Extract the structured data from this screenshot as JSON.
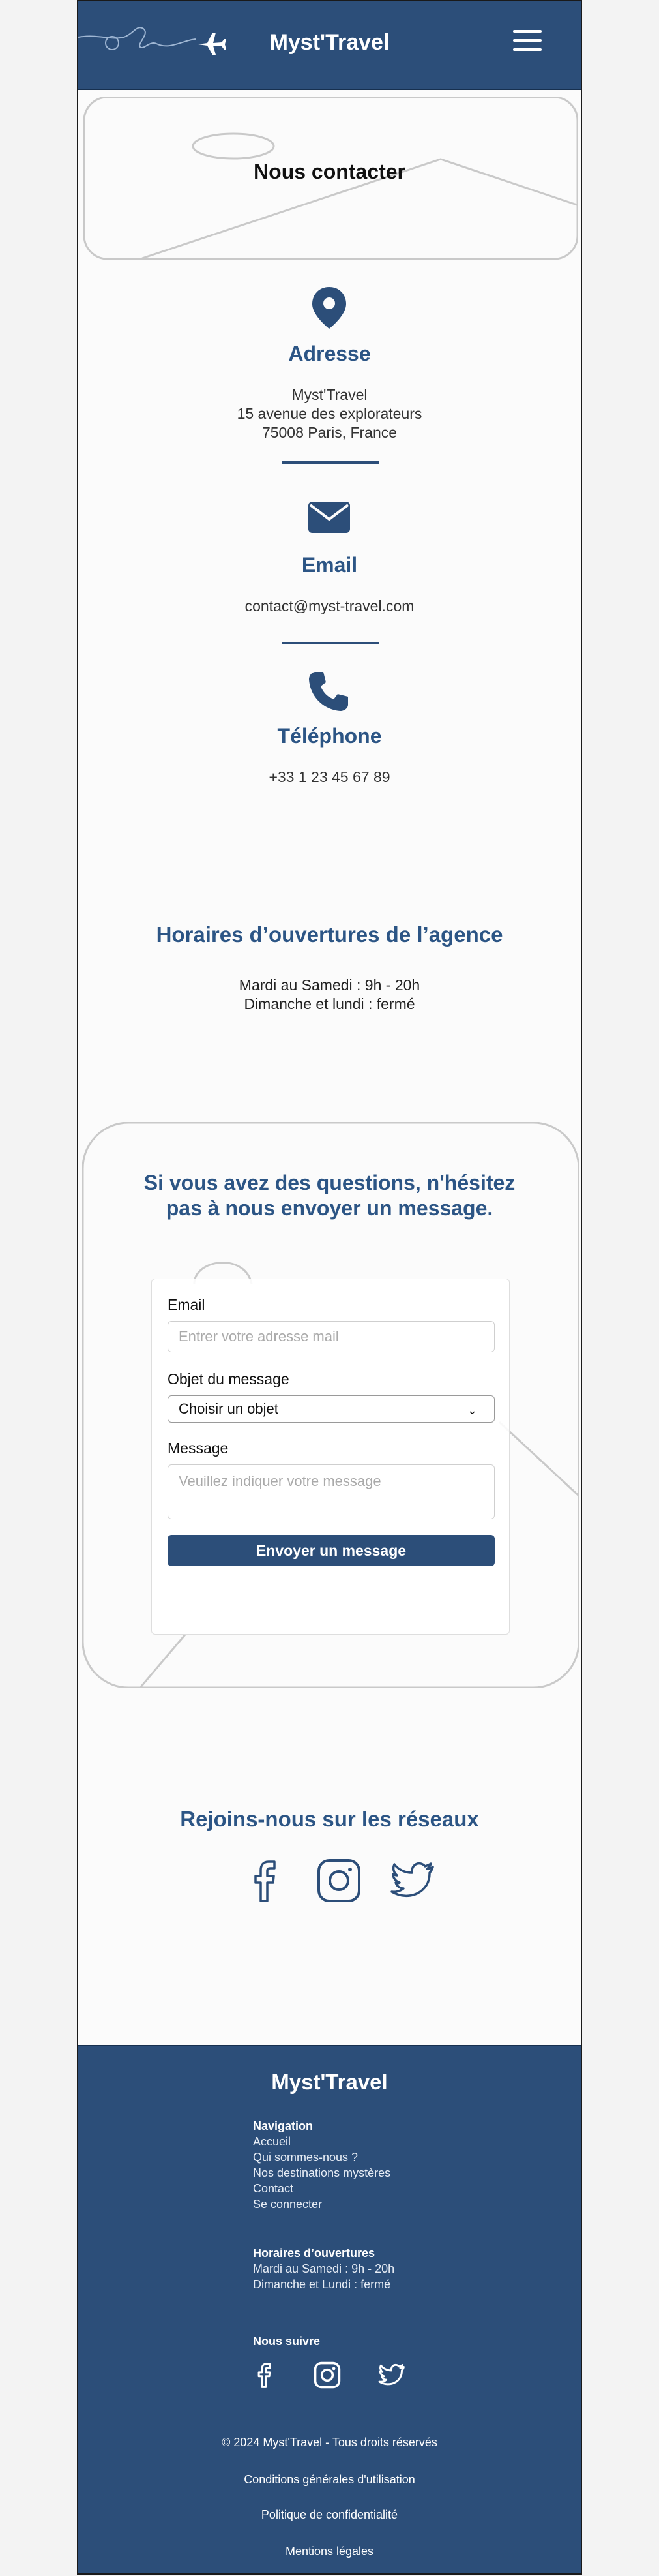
{
  "header": {
    "brand": "Myst'Travel"
  },
  "hero": {
    "title": "Nous contacter"
  },
  "contact": {
    "address": {
      "title": "Adresse",
      "lines": [
        "Myst'Travel",
        "15 avenue des explorateurs",
        "75008 Paris, France"
      ]
    },
    "email": {
      "title": "Email",
      "value": "contact@myst-travel.com"
    },
    "phone": {
      "title": "Téléphone",
      "value": "+33 1 23 45 67 89"
    }
  },
  "hours": {
    "title": "Horaires d’ouvertures de l’agence",
    "lines": [
      "Mardi au Samedi : 9h - 20h",
      "Dimanche et lundi : fermé"
    ]
  },
  "form": {
    "title": "Si vous avez des questions, n'hésitez pas à nous envoyer un message.",
    "email_label": "Email",
    "email_placeholder": "Entrer votre adresse mail",
    "subject_label": "Objet du message",
    "subject_value": "Choisir un objet",
    "message_label": "Message",
    "message_placeholder": "Veuillez indiquer votre message",
    "submit_label": "Envoyer un message"
  },
  "social": {
    "title": "Rejoins-nous sur les réseaux",
    "icons": [
      "facebook-icon",
      "instagram-icon",
      "twitter-icon"
    ]
  },
  "footer": {
    "brand": "Myst'Travel",
    "nav_title": "Navigation",
    "nav_items": [
      "Accueil",
      "Qui sommes-nous ?",
      "Nos destinations mystères",
      "Contact",
      "Se connecter"
    ],
    "hours_title": "Horaires d’ouvertures",
    "hours_lines": [
      "Mardi au Samedi : 9h - 20h",
      "Dimanche et Lundi : fermé"
    ],
    "follow_title": "Nous suivre",
    "copyright": "© 2024 Myst'Travel - Tous droits réservés",
    "links": [
      "Conditions générales d'utilisation",
      "Politique de confidentialité",
      "Mentions légales"
    ]
  },
  "colors": {
    "primary": "#2c4e79",
    "heading": "#2c5585",
    "background": "#fbfbfb"
  }
}
